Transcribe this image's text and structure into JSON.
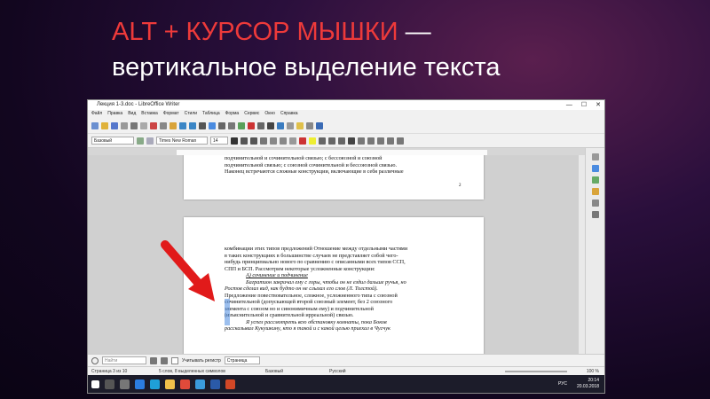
{
  "slide": {
    "title_prefix": "ALT + КУРСОР МЫШКИ",
    "title_dash": " —",
    "title_line2": "вертикальное выделение текста"
  },
  "window": {
    "title": "Лекция 1-3.doc - LibreOffice Writer",
    "controls": [
      "—",
      "☐",
      "✕"
    ]
  },
  "menu": [
    "Файл",
    "Правка",
    "Вид",
    "Вставка",
    "Формат",
    "Стили",
    "Таблица",
    "Форма",
    "Сервис",
    "Окно",
    "Справка"
  ],
  "formatting": {
    "style": "Базовый",
    "font": "Times New Roman",
    "size": "14"
  },
  "document": {
    "page1_lines": [
      "подчинительной и сочинительной связью; с бессоюзной и союзной",
      "подчинительной связью; с союзной сочинительной и бессоюзной связью.",
      "Наконец встречаются сложные конструкции, включающие в себя различные"
    ],
    "page1_number": "2",
    "page2_lines": [
      "комбинации этих типов предложений Отношение между отдельными частями",
      "в таких конструкциях в большинстве случаев не представляет собой чего-",
      "нибудь принципиально нового по сравнению с описанными всех типов ССП,",
      "СПП и БСП. Рассмотрим некоторые усложненные конструкции:",
      "А) сочинение и подчинение",
      "Багратион закричал ему с горы, чтобы он не ездил дальше ручья, но",
      "Ростов сделал вид, как будто он не слыхал его слов (Л. Толстой).",
      "Предложение повествовательное, сложное, усложненного типа с союзной",
      "сочинительной (допускающей второй союзный элемент, без 2 союзного",
      "элемента с союзом но и синонимичным ему) и подчинительной",
      "(изъяснительной и сравнительной ирреальной) связью.",
      "Я успел рассмотреть всю обстановку комнаты, пока Боков",
      "рассказывал Кукушкину, кто я такой и с какой целью приехал в Чусчук"
    ]
  },
  "findbar": {
    "placeholder": "Найти",
    "match_case": "Учитывать регистр",
    "scope": "Страница"
  },
  "status": {
    "page": "Страница 3 из 10",
    "words": "5 слов, 8 выделенных символов",
    "style": "Базовый",
    "language": "Русский",
    "zoom": "100 %"
  },
  "taskbar": {
    "lang": "РУС",
    "time": "20:14",
    "date": "20.03.2018"
  },
  "colors": {
    "accent": "#ee3a3a",
    "selection": "#4a8be0",
    "arrow": "#e11a1a"
  }
}
